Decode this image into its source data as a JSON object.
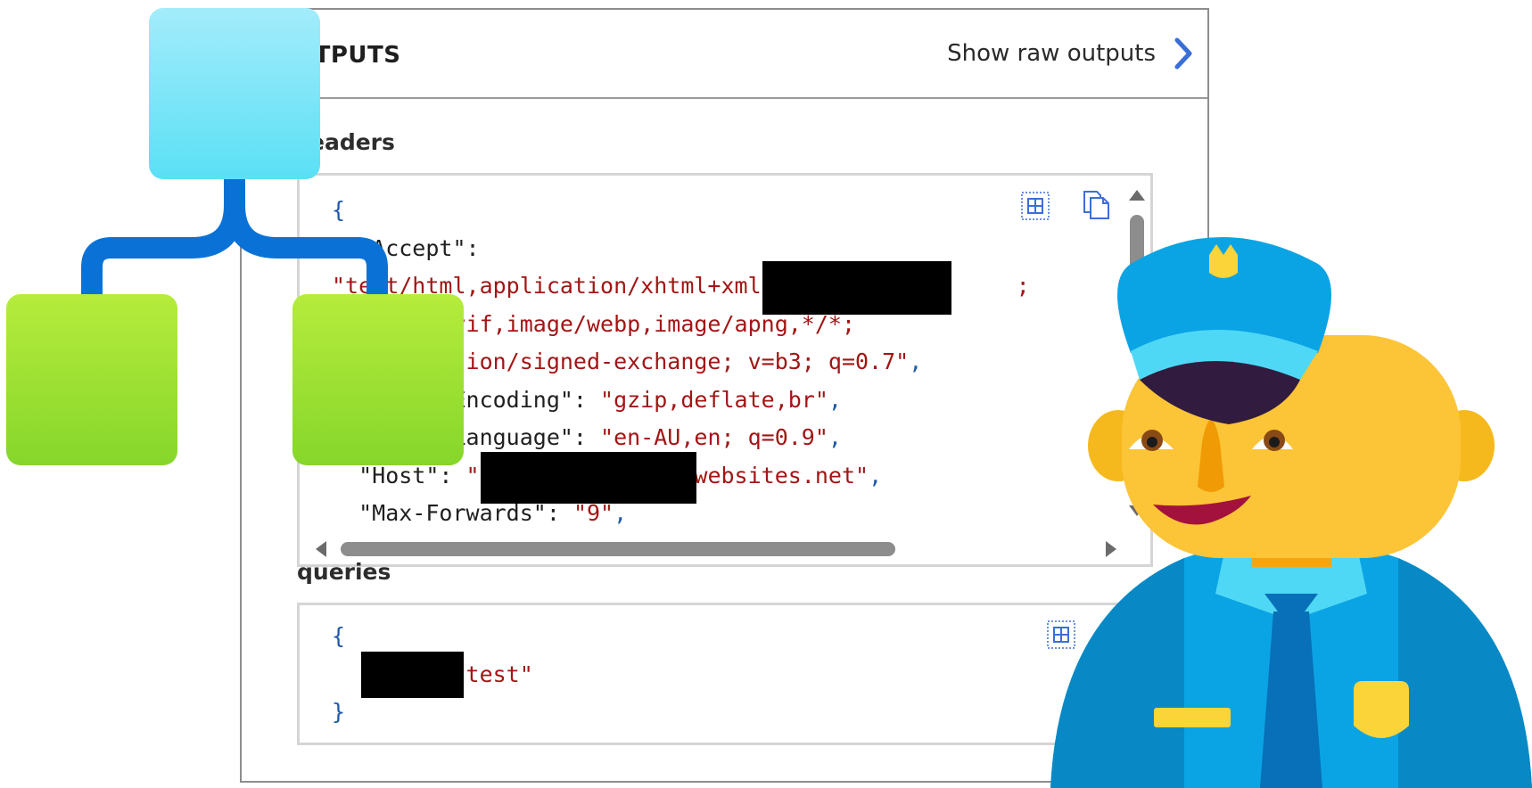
{
  "panel": {
    "title": "UTPUTS",
    "raw_outputs_label": "Show raw outputs"
  },
  "headers": {
    "label": "eaders",
    "lines": [
      {
        "parts": [
          {
            "t": "{",
            "c": "p"
          }
        ]
      },
      {
        "parts": [
          {
            "t": "  \"Accept\":",
            "c": "k"
          }
        ]
      },
      {
        "parts": [
          {
            "t": "\"text/html,application/xhtml+xml",
            "c": "s"
          },
          {
            "t": "                   ;",
            "c": "s"
          }
        ]
      },
      {
        "parts": [
          {
            "t": "     ge/avif,image/webp,image/apng,*/*;",
            "c": "s"
          }
        ]
      },
      {
        "parts": [
          {
            "t": "      ication/signed-exchange; v=b3; q=0.7\"",
            "c": "s"
          },
          {
            "t": ",",
            "c": "p"
          }
        ]
      },
      {
        "parts": [
          {
            "t": "         Encoding\": ",
            "c": "k"
          },
          {
            "t": "\"gzip,deflate,br\"",
            "c": "s"
          },
          {
            "t": ",",
            "c": "p"
          }
        ]
      },
      {
        "parts": [
          {
            "t": "         Language\": ",
            "c": "k"
          },
          {
            "t": "\"en-AU,en; q=0.9\"",
            "c": "s"
          },
          {
            "t": ",",
            "c": "p"
          }
        ]
      },
      {
        "parts": [
          {
            "t": "  \"Host\": ",
            "c": "k"
          },
          {
            "t": "\"           azurewebsites.net\"",
            "c": "s"
          },
          {
            "t": ",",
            "c": "p"
          }
        ]
      },
      {
        "parts": [
          {
            "t": "  \"Max-Forwards\": ",
            "c": "k"
          },
          {
            "t": "\"9\"",
            "c": "s"
          },
          {
            "t": ",",
            "c": "p"
          }
        ]
      }
    ]
  },
  "queries": {
    "label": "queries",
    "lines": [
      {
        "parts": [
          {
            "t": "{",
            "c": "p"
          }
        ]
      },
      {
        "parts": [
          {
            "t": "         ",
            "c": "k"
          },
          {
            "t": "\"test\"",
            "c": "s"
          }
        ]
      },
      {
        "parts": [
          {
            "t": "}",
            "c": "p"
          }
        ]
      }
    ]
  },
  "icons": {
    "table_view": "table-view-icon",
    "copy": "copy-icon",
    "chevron": "chevron-right-icon",
    "logic_app": "logic-app-diagram-icon",
    "police_officer": "police-officer-emoji"
  },
  "colors": {
    "string": "#a31515",
    "punct": "#1f5aa8",
    "accent": "#3b6fd6"
  }
}
